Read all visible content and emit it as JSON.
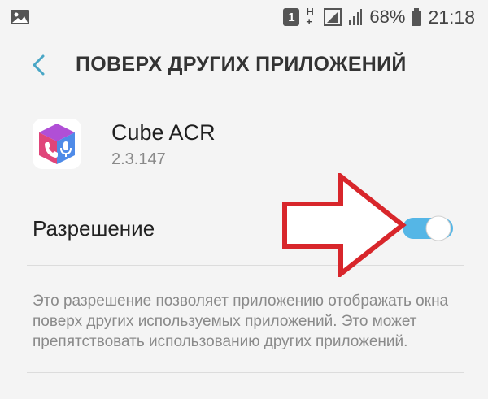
{
  "status_bar": {
    "sim_badge": "1",
    "network": "H+",
    "battery_percent": "68%",
    "time": "21:18"
  },
  "header": {
    "title": "ПОВЕРХ ДРУГИХ ПРИЛОЖЕНИЙ"
  },
  "app": {
    "name": "Cube ACR",
    "version": "2.3.147"
  },
  "permission": {
    "label": "Разрешение",
    "enabled": true,
    "description": "Это разрешение позволяет приложению отображать окна поверх других используемых приложений. Это может препятствовать использованию других приложений."
  },
  "colors": {
    "toggle_on": "#55b6e6",
    "back_arrow": "#4aa7c6",
    "annotation_arrow": "#d8262b"
  }
}
